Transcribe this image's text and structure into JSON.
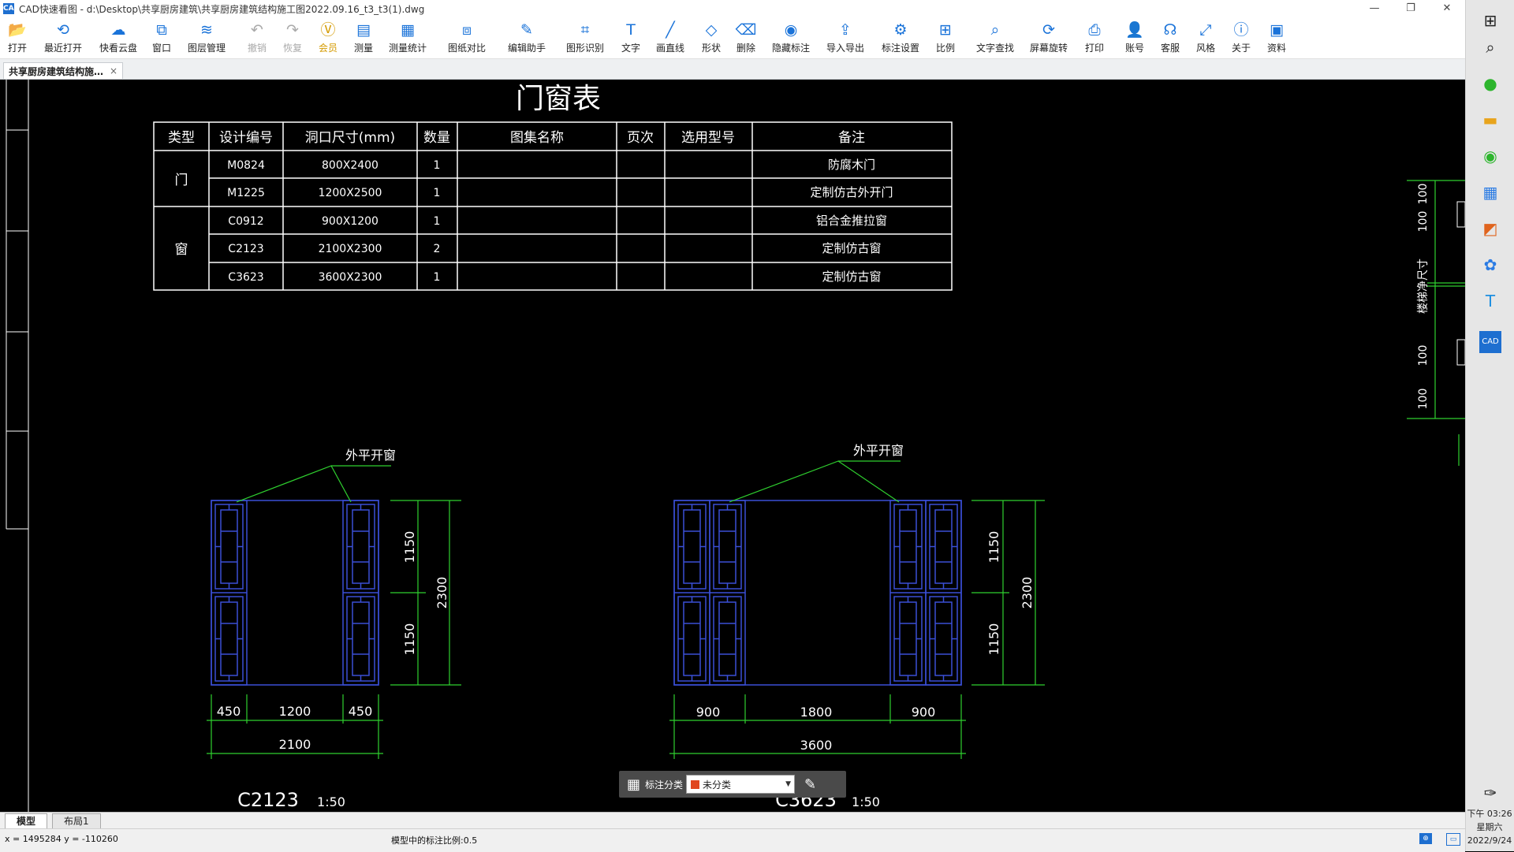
{
  "window": {
    "title": "CAD快速看图 - d:\\Desktop\\共享厨房建筑\\共享厨房建筑结构施工图2022.09.16_t3_t3(1).dwg",
    "app_icon_text": "CAD",
    "controls": [
      "—",
      "❐",
      "✕"
    ]
  },
  "toolbar": [
    {
      "name": "open",
      "label": "打开",
      "icon": "📂"
    },
    {
      "name": "recent",
      "label": "最近打开",
      "icon": "⟲"
    },
    {
      "name": "cloud",
      "label": "快看云盘",
      "icon": "☁"
    },
    {
      "name": "window",
      "label": "窗口",
      "icon": "⧉"
    },
    {
      "name": "layers",
      "label": "图层管理",
      "icon": "≋"
    },
    {
      "name": "undo",
      "label": "撤销",
      "icon": "↶",
      "disabled": true
    },
    {
      "name": "redo",
      "label": "恢复",
      "icon": "↷",
      "disabled": true
    },
    {
      "name": "vip",
      "label": "会员",
      "icon": "Ⓥ",
      "vip": true
    },
    {
      "name": "measure",
      "label": "测量",
      "icon": "▤"
    },
    {
      "name": "measure-stats",
      "label": "测量统计",
      "icon": "▦"
    },
    {
      "name": "compare",
      "label": "图纸对比",
      "icon": "⧈"
    },
    {
      "name": "edit-assist",
      "label": "编辑助手",
      "icon": "✎"
    },
    {
      "name": "shape-recog",
      "label": "图形识别",
      "icon": "⌗"
    },
    {
      "name": "text",
      "label": "文字",
      "icon": "T"
    },
    {
      "name": "line",
      "label": "画直线",
      "icon": "╱"
    },
    {
      "name": "shape",
      "label": "形状",
      "icon": "◇"
    },
    {
      "name": "delete",
      "label": "删除",
      "icon": "⌫"
    },
    {
      "name": "hide-anno",
      "label": "隐藏标注",
      "icon": "◉"
    },
    {
      "name": "import-export",
      "label": "导入导出",
      "icon": "⇪"
    },
    {
      "name": "anno-settings",
      "label": "标注设置",
      "icon": "⚙"
    },
    {
      "name": "scale",
      "label": "比例",
      "icon": "⊞"
    },
    {
      "name": "text-search",
      "label": "文字查找",
      "icon": "⌕"
    },
    {
      "name": "screen-rotate",
      "label": "屏幕旋转",
      "icon": "⟳"
    },
    {
      "name": "print",
      "label": "打印",
      "icon": "⎙"
    },
    {
      "name": "account",
      "label": "账号",
      "icon": "👤"
    },
    {
      "name": "support",
      "label": "客服",
      "icon": "☊"
    },
    {
      "name": "style",
      "label": "风格",
      "icon": "⤢"
    },
    {
      "name": "about",
      "label": "关于",
      "icon": "ⓘ"
    },
    {
      "name": "resources",
      "label": "资料",
      "icon": "▣"
    }
  ],
  "doc_tab": {
    "label": "共享厨房建筑结构施…",
    "close": "×"
  },
  "drawing": {
    "table_title": "门窗表",
    "headers": [
      "类型",
      "设计编号",
      "洞口尺寸(mm)",
      "数量",
      "图集名称",
      "页次",
      "选用型号",
      "备注"
    ],
    "groups": [
      {
        "type": "门",
        "rows": [
          {
            "code": "M0824",
            "size": "800X2400",
            "qty": "1",
            "note": "防腐木门"
          },
          {
            "code": "M1225",
            "size": "1200X2500",
            "qty": "1",
            "note": "定制仿古外开门"
          }
        ]
      },
      {
        "type": "窗",
        "rows": [
          {
            "code": "C0912",
            "size": "900X1200",
            "qty": "1",
            "note": "铝合金推拉窗"
          },
          {
            "code": "C2123",
            "size": "2100X2300",
            "qty": "2",
            "note": "定制仿古窗"
          },
          {
            "code": "C3623",
            "size": "3600X2300",
            "qty": "1",
            "note": "定制仿古窗"
          }
        ]
      }
    ],
    "window1": {
      "leader": "外平开窗",
      "dims_bottom": [
        "450",
        "1200",
        "450"
      ],
      "total_width": "2100",
      "dims_right": [
        "1150",
        "1150"
      ],
      "total_height": "2300",
      "name": "C2123",
      "scale": "1:50"
    },
    "window2": {
      "leader": "外平开窗",
      "dims_bottom": [
        "900",
        "1800",
        "900"
      ],
      "total_width": "3600",
      "dims_right": [
        "1150",
        "1150"
      ],
      "total_height": "2300",
      "name": "C3623",
      "scale": "1:50"
    },
    "right_fragment": {
      "dims": [
        "100",
        "100",
        "100",
        "100"
      ],
      "label": "楼梯净尺寸"
    }
  },
  "annotation_bar": {
    "label": "标注分类",
    "selected": "未分类",
    "swatch": "#e0461e"
  },
  "layout_tabs": [
    "模型",
    "布局1"
  ],
  "status": {
    "coords": "x = 1495284  y = -110260",
    "scale_text": "模型中的标注比例:0.5"
  },
  "taskbar": {
    "time": "下午 03:26",
    "weekday": "星期六",
    "date": "2022/9/24"
  }
}
